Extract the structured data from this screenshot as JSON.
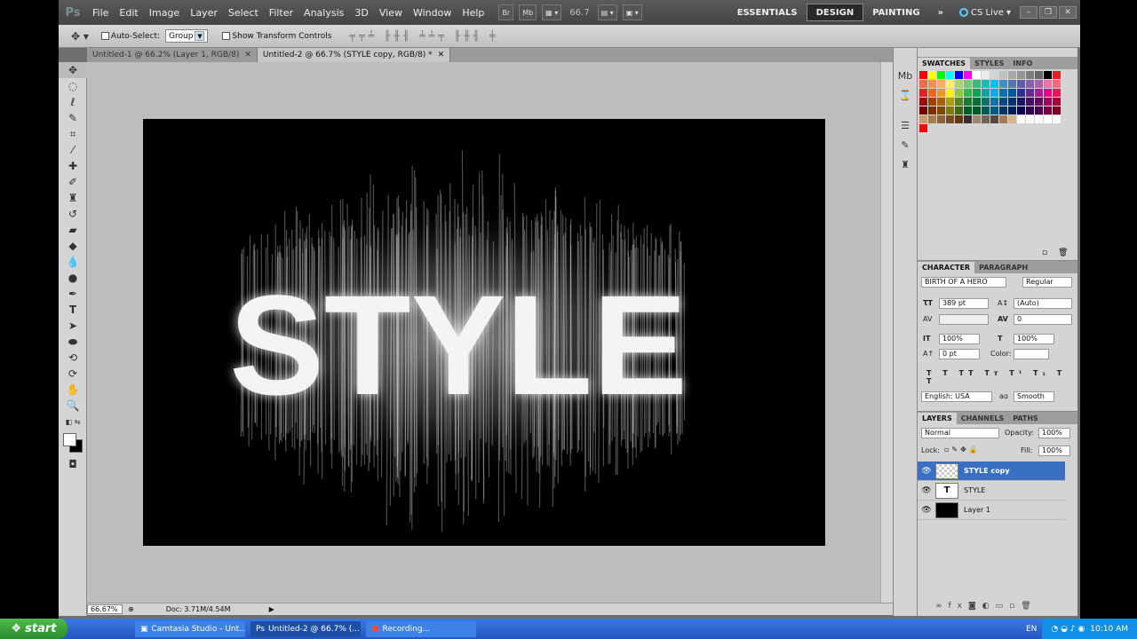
{
  "menubar": {
    "logo": "Ps",
    "items": [
      "File",
      "Edit",
      "Image",
      "Layer",
      "Select",
      "Filter",
      "Analysis",
      "3D",
      "View",
      "Window",
      "Help"
    ],
    "bridge_label": "Br",
    "minibridge_label": "Mb",
    "zoom": "66.7",
    "workspaces": [
      "ESSENTIALS",
      "DESIGN",
      "PAINTING"
    ],
    "cslive": "CS Live"
  },
  "options": {
    "auto_select_label": "Auto-Select:",
    "auto_select_value": "Group",
    "show_transform_label": "Show Transform Controls"
  },
  "doc_tabs": [
    {
      "label": "Untitled-1 @ 66.2% (Layer 1, RGB/8)"
    },
    {
      "label": "Untitled-2 @ 66.7% (STYLE copy, RGB/8) *"
    }
  ],
  "canvas": {
    "text": "STYLE"
  },
  "status": {
    "zoom": "66.67%",
    "doc": "Doc: 3.71M/4.54M"
  },
  "swatches_panel": {
    "tabs": [
      "SWATCHES",
      "STYLES",
      "INFO"
    ],
    "colors": [
      "#ff0000",
      "#ffff00",
      "#00ff00",
      "#00ffff",
      "#0000ff",
      "#ff00ff",
      "#ffffff",
      "#eaeaea",
      "#d4d4d4",
      "#bfbfbf",
      "#a9a9a9",
      "#949494",
      "#7e7e7e",
      "#696969",
      "#000000",
      "#ed1c24",
      "#f26c4f",
      "#f68e55",
      "#fbaf5c",
      "#fff467",
      "#acd372",
      "#7cc576",
      "#3bb878",
      "#1abbb4",
      "#00bff3",
      "#438ccb",
      "#5574b9",
      "#605ca8",
      "#855fa8",
      "#a763a8",
      "#f06ea9",
      "#f26d7d",
      "#ed1c24",
      "#f26522",
      "#f7941d",
      "#fff200",
      "#8dc63f",
      "#39b54a",
      "#00a651",
      "#00a99d",
      "#00aeef",
      "#0072bc",
      "#0054a6",
      "#2e3192",
      "#662d91",
      "#92278f",
      "#ec008c",
      "#ed145b",
      "#9e0b0f",
      "#a0410d",
      "#a36209",
      "#aba000",
      "#598527",
      "#1a7b30",
      "#007236",
      "#00746b",
      "#0076a3",
      "#004b80",
      "#003471",
      "#1b1464",
      "#440e62",
      "#630460",
      "#9e005d",
      "#9e0039",
      "#790000",
      "#7b2e00",
      "#7d4900",
      "#827b00",
      "#406618",
      "#005e20",
      "#005826",
      "#005952",
      "#005b7f",
      "#003663",
      "#002157",
      "#0d004c",
      "#32004b",
      "#4b0049",
      "#7b0046",
      "#7a0026",
      "#c69c6d",
      "#a67c52",
      "#8c6239",
      "#754c24",
      "#603913",
      "#362f2d",
      "#998675",
      "#736357",
      "#534741",
      "#a27b5b",
      "#d2b48c",
      "#ffffff",
      "#ffffff",
      "#ffffff",
      "#ffffff",
      "#ffffff",
      "#ff0000"
    ]
  },
  "character_panel": {
    "tabs": [
      "CHARACTER",
      "PARAGRAPH"
    ],
    "font_family": "BIRTH OF A HERO",
    "font_style": "Regular",
    "font_size": "389 pt",
    "leading": "(Auto)",
    "tracking": "0",
    "vscale": "100%",
    "hscale": "100%",
    "baseline": "0 pt",
    "color_label": "Color:",
    "language": "English: USA",
    "antialias_label": "aɑ",
    "antialias": "Smooth"
  },
  "layers_panel": {
    "tabs": [
      "LAYERS",
      "CHANNELS",
      "PATHS"
    ],
    "blend_mode": "Normal",
    "opacity_label": "Opacity:",
    "opacity": "100%",
    "lock_label": "Lock:",
    "fill_label": "Fill:",
    "fill": "100%",
    "layers": [
      {
        "name": "STYLE copy",
        "thumb": "",
        "active": true
      },
      {
        "name": "STYLE",
        "thumb": "T",
        "active": false
      },
      {
        "name": "Layer 1",
        "thumb": "",
        "active": false
      }
    ]
  },
  "taskbar": {
    "start": "start",
    "tasks": [
      "Camtasia Studio - Unt...",
      "Untitled-2 @ 66.7% (...",
      "Recording..."
    ],
    "lang": "EN",
    "clock": "10:10 AM"
  }
}
